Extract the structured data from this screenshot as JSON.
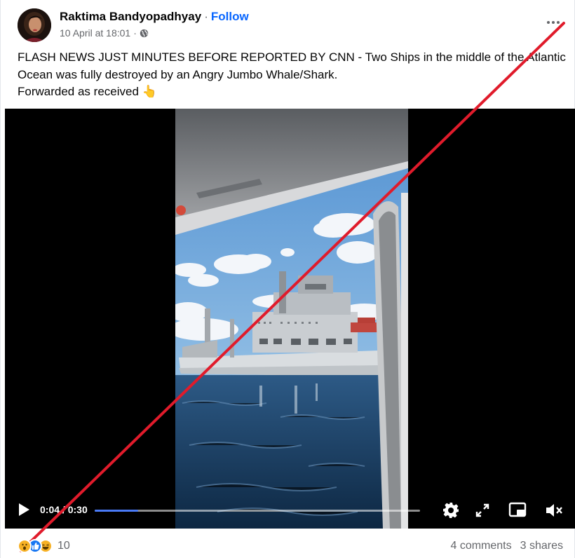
{
  "post": {
    "author": "Raktima Bandyopadhyay",
    "separator": "·",
    "follow_label": "Follow",
    "timestamp": "10 April at 18:01",
    "timestamp_separator": "·",
    "text_lines": [
      "FLASH NEWS JUST MINUTES BEFORE REPORTED BY CNN - Two Ships in the middle of the Atlantic",
      "Ocean was fully destroyed by an Angry Jumbo Whale/Shark.",
      "Forwarded as received 👆"
    ]
  },
  "video": {
    "current_time": "0:04",
    "time_separator": " / ",
    "duration": "0:30",
    "progress_fraction": 0.133
  },
  "footer": {
    "reaction_count": "10",
    "comments": "4 comments",
    "shares": "3 shares"
  },
  "colors": {
    "follow": "#0866ff",
    "muted_text": "#65676b",
    "progress_fill": "#4a7bf7",
    "overlay_line": "#e01b2b"
  },
  "icons": [
    "more-options-icon",
    "globe-icon",
    "play-icon",
    "settings-icon",
    "fullscreen-icon",
    "picture-in-picture-icon",
    "mute-icon",
    "wow-reaction-icon",
    "like-reaction-icon",
    "haha-reaction-icon"
  ]
}
